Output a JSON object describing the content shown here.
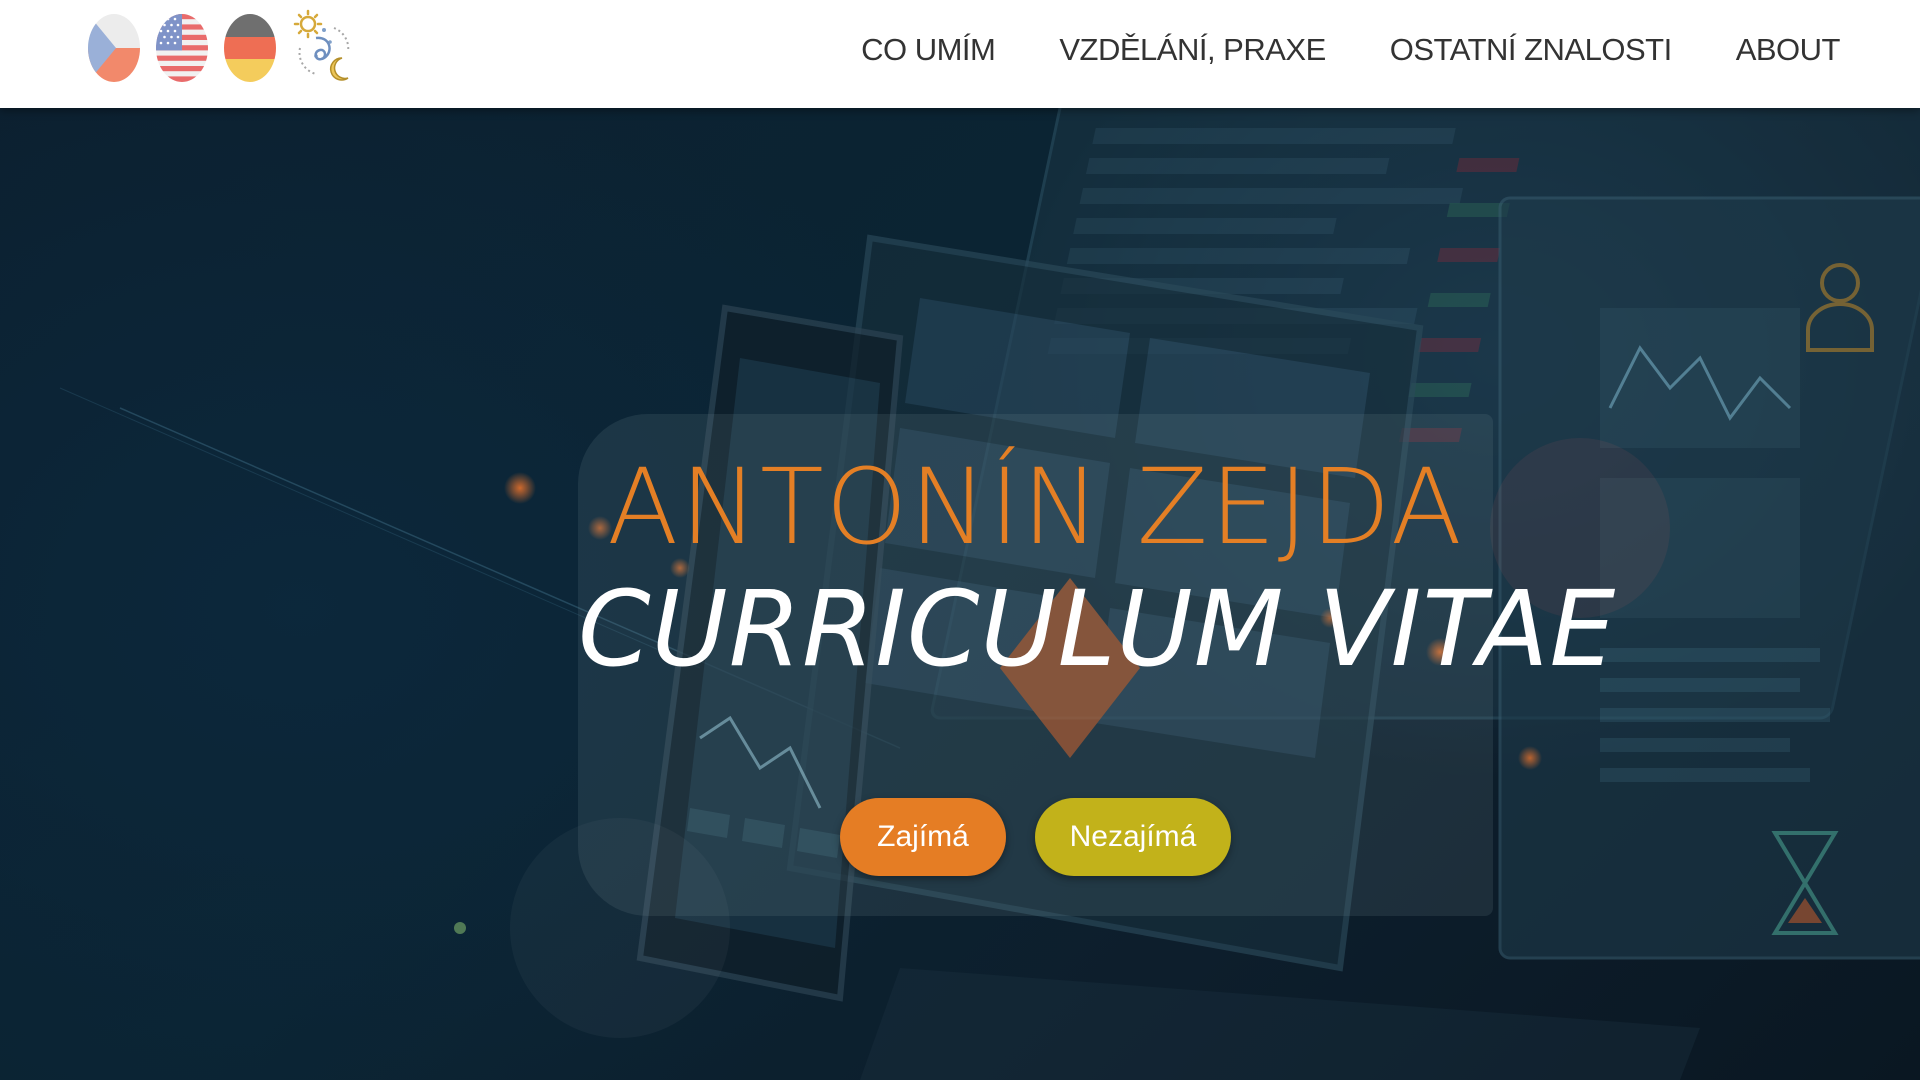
{
  "header": {
    "languages": [
      {
        "code": "cs",
        "icon": "czech-flag-icon"
      },
      {
        "code": "en",
        "icon": "us-flag-icon"
      },
      {
        "code": "de",
        "icon": "german-flag-icon"
      }
    ],
    "theme_toggle_icon": "sun-moon-icon"
  },
  "nav": {
    "items": [
      {
        "label": "CO UMÍM"
      },
      {
        "label": "VZDĚLÁNÍ, PRAXE"
      },
      {
        "label": "OSTATNÍ ZNALOSTI"
      },
      {
        "label": "ABOUT"
      }
    ]
  },
  "hero": {
    "name": "ANTONÍN ZEJDA",
    "subtitle": "CURRICULUM VITAE",
    "buttons": {
      "interested": "Zajímá",
      "not_interested": "Nezajímá"
    }
  },
  "colors": {
    "accent_orange": "#e57d24",
    "accent_olive": "#c2b21a",
    "hero_background": "#0b2433",
    "header_background": "#ffffff"
  }
}
